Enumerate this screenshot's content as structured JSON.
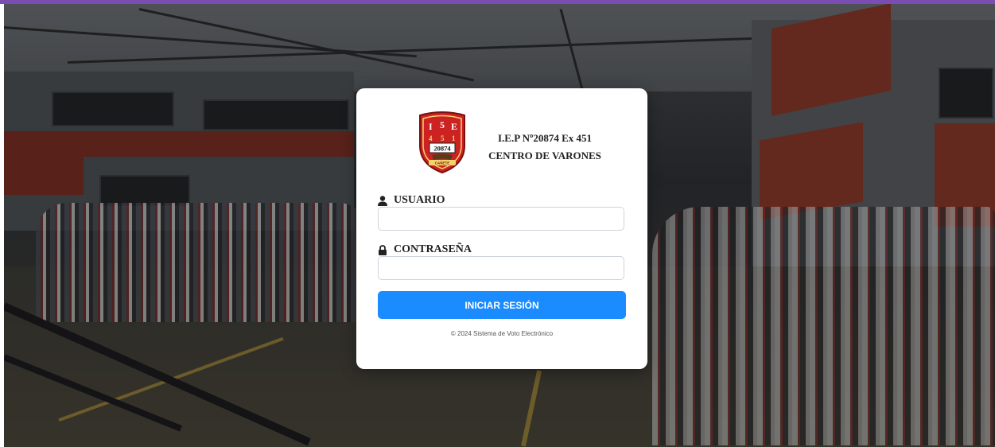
{
  "theme": {
    "accent_bar": "#7b4db3",
    "button_color": "#1a8cff",
    "card_background": "#ffffff"
  },
  "logo": {
    "letters_top": [
      "I",
      "5",
      "E"
    ],
    "digits": [
      "4",
      "5",
      "1"
    ],
    "number": "20874",
    "banner": "CAÑETE",
    "icon": "school-shield-crest"
  },
  "school": {
    "line1": "I.E.P Nº20874 Ex 451",
    "line2": "CENTRO DE VARONES"
  },
  "form": {
    "usuario_label": "USUARIO",
    "usuario_icon": "user-icon",
    "usuario_value": "",
    "contrasena_label": "CONTRASEÑA",
    "contrasena_icon": "lock-icon",
    "contrasena_value": "",
    "submit_label": "INICIAR SESIÓN"
  },
  "footer": {
    "text": "© 2024 Sistema de Voto Electrónico"
  }
}
